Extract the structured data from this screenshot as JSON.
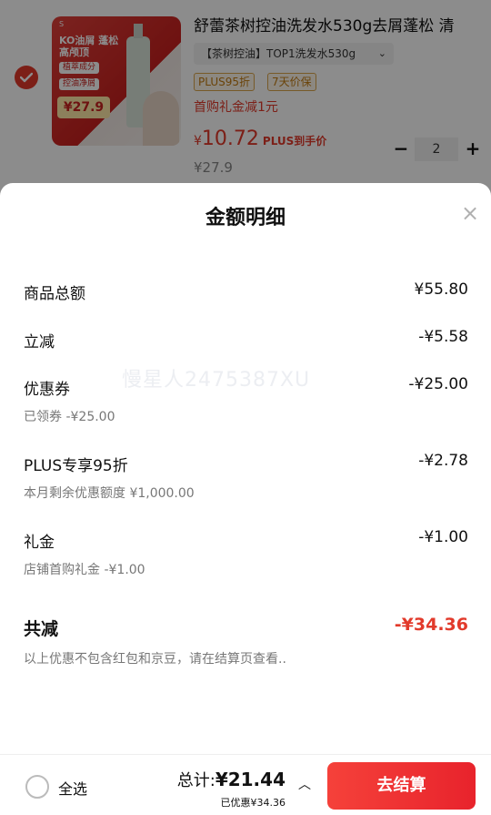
{
  "product": {
    "thumb_brand": "S",
    "thumb_headline": "KO油屑 蓬松高颅顶",
    "thumb_tag1": "植萃成分",
    "thumb_tag2": "控油净屑",
    "thumb_price": "¥27.9",
    "title": "舒蕾茶树控油洗发水530g去屑蓬松 清",
    "variant": "【茶树控油】TOP1洗发水530g",
    "variant_chevron": "⌄",
    "badge_plus": "PLUS95折",
    "badge_price_protect": "7天价保",
    "first_gift": "首购礼金减1元",
    "price_symbol": "¥",
    "price_value": "10.72",
    "price_plus_label": "PLUS到手价",
    "original_price": "¥27.9",
    "quantity": "2",
    "minus_label": "−",
    "plus_label": "+"
  },
  "sheet": {
    "title": "金额明细",
    "close_label": "×",
    "watermark": "慢星人2475387XU",
    "rows": [
      {
        "label": "商品总额",
        "value": "¥55.80",
        "sub": ""
      },
      {
        "label": "立减",
        "value": "-¥5.58",
        "sub": ""
      },
      {
        "label": "优惠券",
        "value": "-¥25.00",
        "sub": "已领券 -¥25.00"
      },
      {
        "label": "PLUS专享95折",
        "value": "-¥2.78",
        "sub": "本月剩余优惠额度 ¥1,000.00"
      },
      {
        "label": "礼金",
        "value": "-¥1.00",
        "sub": "店铺首购礼金 -¥1.00"
      }
    ],
    "total_label": "共减",
    "total_value": "-¥34.36",
    "note": "以上优惠不包含红包和京豆，请在结算页查看.."
  },
  "bottom": {
    "select_all": "全选",
    "total_label": "总计:",
    "total_amount": "¥21.44",
    "saved": "已优惠¥34.36",
    "caret": "︿",
    "checkout": "去结算"
  },
  "colors": {
    "accent": "#e23a2b",
    "badge": "#c27a10"
  }
}
